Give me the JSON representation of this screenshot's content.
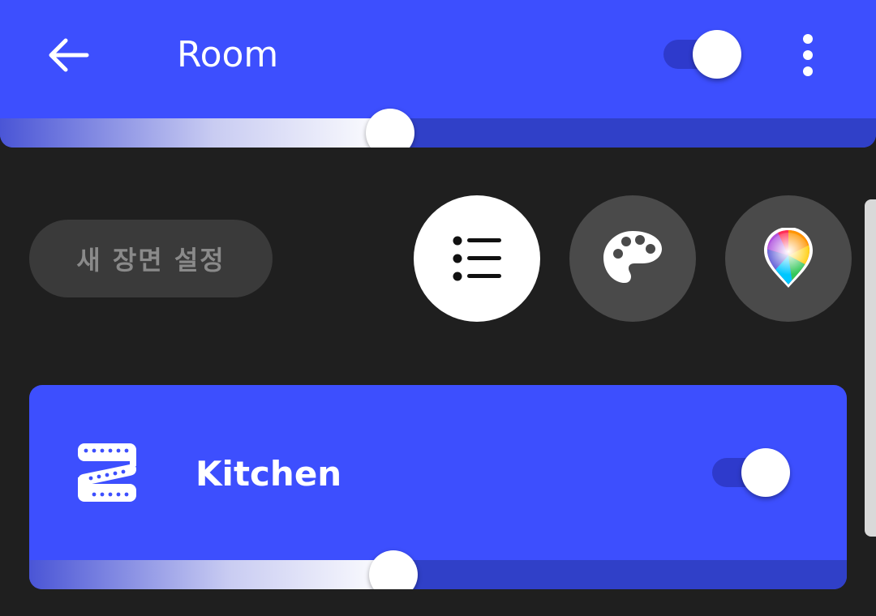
{
  "header": {
    "title": "Room",
    "power_on": true,
    "brightness_fraction": 0.445
  },
  "icons": {
    "back": "arrow-left-icon",
    "more": "more-vertical-icon",
    "list_mode": "list-icon",
    "palette_mode": "palette-icon",
    "color_mode": "color-picker-icon",
    "device": "light-strip-icon"
  },
  "scenes": {
    "new_scene_label": "새 장면 설정",
    "active_mode": "list"
  },
  "devices": [
    {
      "name": "Kitchen",
      "power_on": true,
      "brightness_fraction": 0.445
    }
  ],
  "colors": {
    "accent": "#3d4ffe",
    "background": "#1f1f1f",
    "button_dark": "#4a4a4a",
    "pill_bg": "#3a3a3a"
  }
}
